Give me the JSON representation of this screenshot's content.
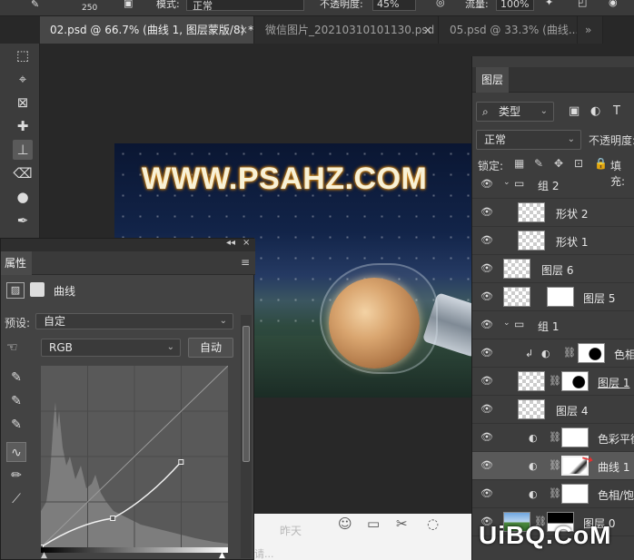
{
  "optbar": {
    "brush_size": "250",
    "mode_label": "模式:",
    "mode_value": "正常",
    "opacity_label": "不透明度:",
    "opacity_value": "45%",
    "flow_label": "流量:",
    "flow_value": "100%"
  },
  "tabs": [
    {
      "label": "02.psd @ 66.7% (曲线 1, 图层蒙版/8) *",
      "close": "×"
    },
    {
      "label": "微信图片_20210310101130.psd",
      "close": "×"
    },
    {
      "label": "05.psd @ 33.3% (曲线..."
    }
  ],
  "tabs_overflow": "»",
  "canvas": {
    "headline": "WWW.PSAHZ.COM"
  },
  "properties": {
    "tab_label": "属性",
    "collapse": "◂◂",
    "close": "×",
    "menu": "≡",
    "adjustment_name": "曲线",
    "preset_label": "预设:",
    "preset_value": "自定",
    "channel_value": "RGB",
    "auto_button": "自动"
  },
  "layers": {
    "tab_label": "图层",
    "filter_value": "类型",
    "blend_value": "正常",
    "opacity_label": "不透明度:",
    "lock_label": "锁定:",
    "fill_label": "填充:",
    "rows": [
      {
        "name": "组 2"
      },
      {
        "name": "形状 2"
      },
      {
        "name": "形状 1"
      },
      {
        "name": "图层 6"
      },
      {
        "name": "图层 5"
      },
      {
        "name": "组 1"
      },
      {
        "name": "色相"
      },
      {
        "name": "图层 1"
      },
      {
        "name": "图层 4"
      },
      {
        "name": "色彩平衡"
      },
      {
        "name": "曲线 1"
      },
      {
        "name": "色相/饱"
      },
      {
        "name": "图层 0"
      }
    ]
  },
  "chatbar": {
    "yesterday": "昨天",
    "partial": "请..."
  },
  "watermark": "UiBQ.CoM",
  "curve": {
    "points": [
      [
        0,
        0
      ],
      [
        98,
        0.16
      ],
      [
        191,
        0.47
      ]
    ],
    "channel_max": 255
  }
}
